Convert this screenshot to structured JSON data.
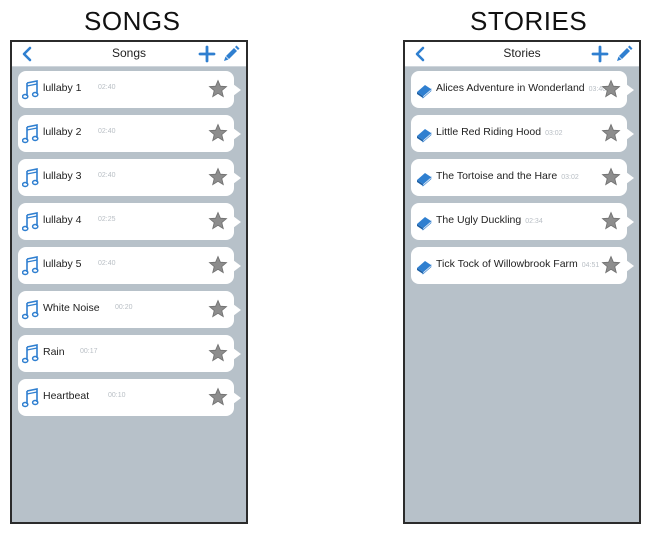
{
  "songs_section": {
    "heading": "SONGS"
  },
  "stories_section": {
    "heading": "STORIES"
  },
  "songs_screen": {
    "title": "Songs",
    "items": [
      {
        "name": "lullaby 1",
        "duration": "02:40"
      },
      {
        "name": "lullaby 2",
        "duration": "02:40"
      },
      {
        "name": "lullaby 3",
        "duration": "02:40"
      },
      {
        "name": "lullaby 4",
        "duration": "02:25"
      },
      {
        "name": "lullaby 5",
        "duration": "02:40"
      },
      {
        "name": "White Noise",
        "duration": "00:20"
      },
      {
        "name": "Rain",
        "duration": "00:17"
      },
      {
        "name": "Heartbeat",
        "duration": "00:10"
      }
    ]
  },
  "stories_screen": {
    "title": "Stories",
    "items": [
      {
        "name": "Alices Adventure in Wonderland",
        "duration": "03:40"
      },
      {
        "name": "Little Red Riding Hood",
        "duration": "03:02"
      },
      {
        "name": "The Tortoise and the Hare",
        "duration": "03:02"
      },
      {
        "name": "The Ugly Duckling",
        "duration": "02:34"
      },
      {
        "name": "Tick Tock of Willowbrook Farm",
        "duration": "04:51"
      }
    ]
  },
  "colors": {
    "accent": "#2f7fd0",
    "list_bg": "#b7c1c9",
    "star": "#8d8d8d"
  },
  "icons": {
    "back": "chevron-left-icon",
    "add": "plus-icon",
    "edit": "pencil-icon",
    "song": "music-note-icon",
    "story": "book-icon",
    "favorite": "star-icon"
  }
}
